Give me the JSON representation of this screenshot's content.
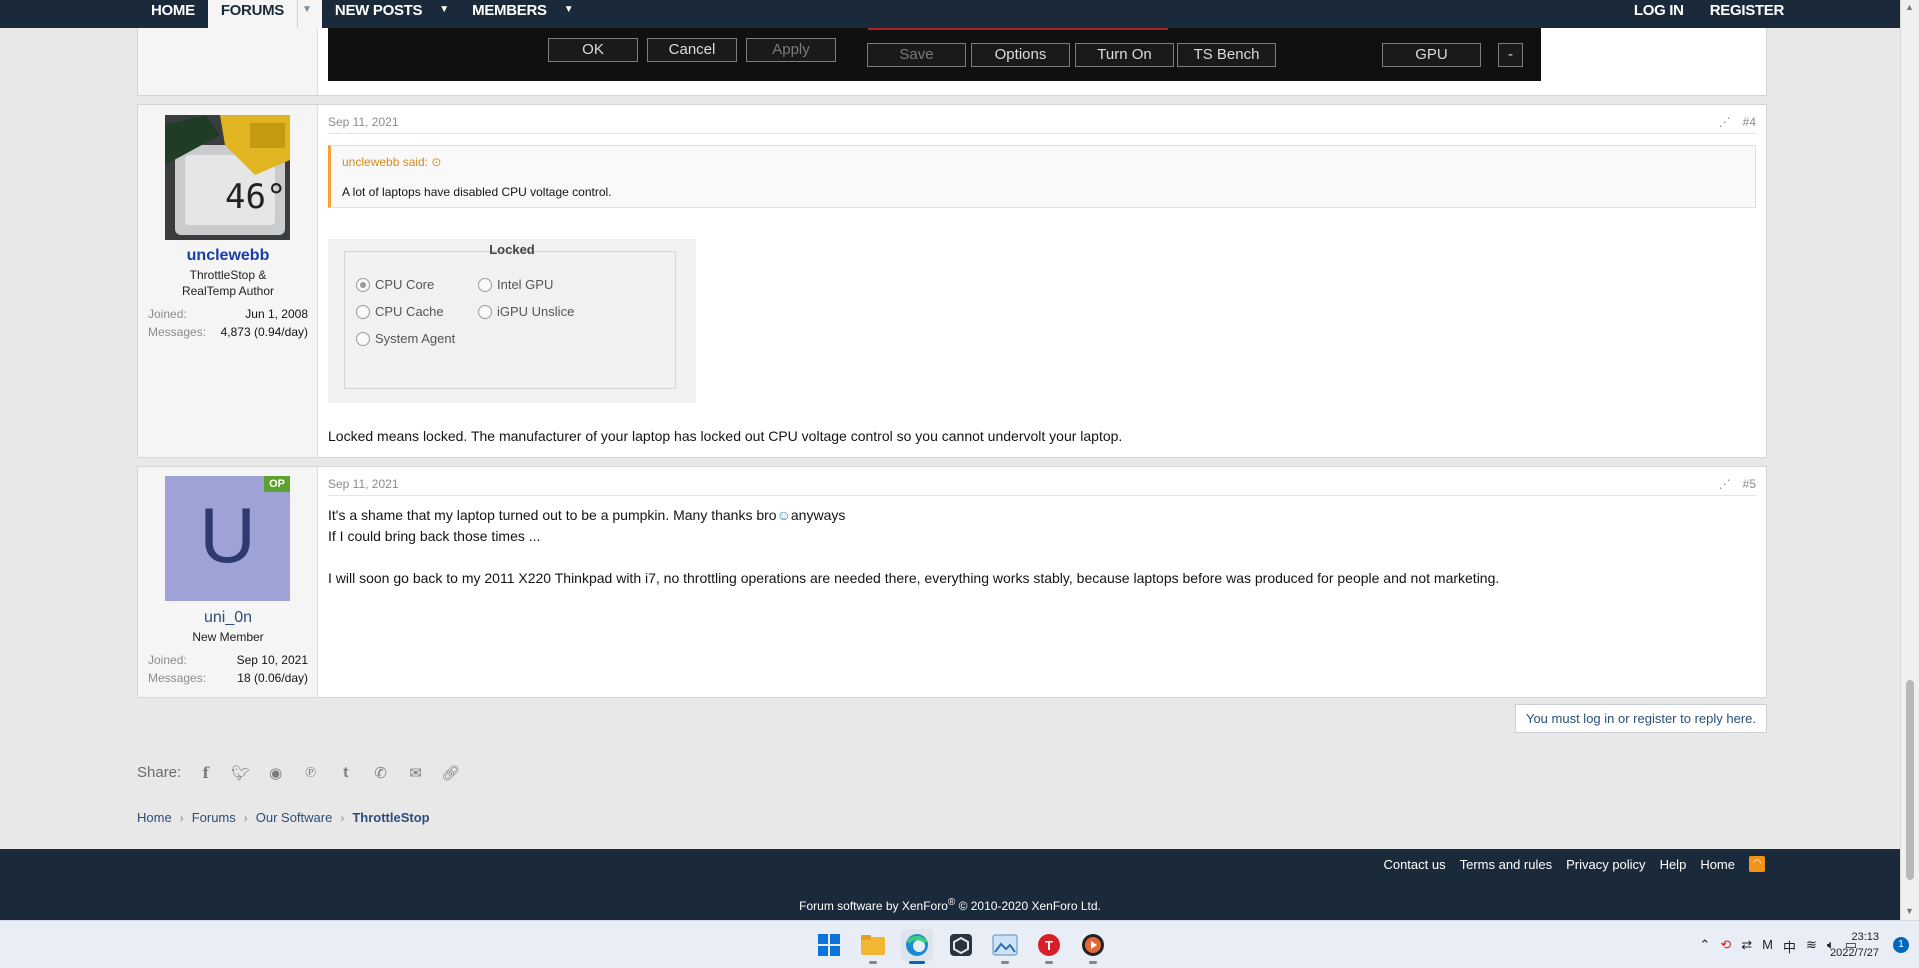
{
  "nav": {
    "items": [
      {
        "label": "HOME"
      },
      {
        "label": "FORUMS"
      },
      {
        "label": "NEW POSTS"
      },
      {
        "label": "MEMBERS"
      }
    ],
    "login": "LOG IN",
    "register": "REGISTER"
  },
  "ts_panel": {
    "ok": "OK",
    "cancel": "Cancel",
    "apply": "Apply",
    "save": "Save",
    "options": "Options",
    "turn_on": "Turn On",
    "ts_bench": "TS Bench",
    "gpu": "GPU",
    "minus": "-"
  },
  "post4": {
    "date": "Sep 11, 2021",
    "number": "#4",
    "user": "unclewebb",
    "user_title": "ThrottleStop & RealTemp Author",
    "joined_label": "Joined:",
    "joined": "Jun 1, 2008",
    "messages_label": "Messages:",
    "messages": "4,873 (0.94/day)",
    "avatar_temp": "46°",
    "quote_header": "unclewebb said:",
    "quote_body": "A lot of laptops have disabled CPU voltage control.",
    "locked_title": "Locked",
    "locked_options": [
      "CPU Core",
      "Intel GPU",
      "CPU Cache",
      "iGPU Unslice",
      "System Agent"
    ],
    "body": "Locked means locked. The manufacturer of your laptop has locked out CPU voltage control so you cannot undervolt your laptop."
  },
  "post5": {
    "date": "Sep 11, 2021",
    "number": "#5",
    "user": "uni_0n",
    "avatar_letter": "U",
    "op_badge": "OP",
    "user_title": "New Member",
    "joined_label": "Joined:",
    "joined": "Sep 10, 2021",
    "messages_label": "Messages:",
    "messages": "18 (0.06/day)",
    "line1a": "It's a shame that my laptop turned out to be a pumpkin. Many thanks bro",
    "line1b": "anyways",
    "line2": "If I could bring back those times ...",
    "line3": "I will soon go back to my 2011 X220 Thinkpad with i7, no throttling operations are needed there, everything works stably, because laptops before was produced for people and not marketing."
  },
  "reply_notice": "You must log in or register to reply here.",
  "share_label": "Share:",
  "share_icons": [
    "facebook-icon",
    "twitter-icon",
    "reddit-icon",
    "pinterest-icon",
    "tumblr-icon",
    "whatsapp-icon",
    "email-icon",
    "link-icon"
  ],
  "breadcrumbs": [
    "Home",
    "Forums",
    "Our Software",
    "ThrottleStop"
  ],
  "footer": {
    "links": [
      "Contact us",
      "Terms and rules",
      "Privacy policy",
      "Help",
      "Home"
    ],
    "copyright_pre": "Forum software by XenForo",
    "copyright_reg": "®",
    "copyright_post": " © 2010-2020 XenForo Ltd."
  },
  "taskbar": {
    "apps": [
      "windows-start-icon",
      "file-explorer-icon",
      "edge-browser-icon",
      "app-cube-icon",
      "image-viewer-icon",
      "throttlestop-icon",
      "media-player-icon"
    ],
    "time": "23:13",
    "date": "2022/7/27",
    "ime": "中",
    "notifications": "1"
  },
  "colors": {
    "nav_bg": "#1b2a3a",
    "link": "#2b4e78",
    "quote_accent": "#f7a034",
    "op_badge": "#5da12f",
    "avatar_u_bg": "#9fa2d4"
  }
}
